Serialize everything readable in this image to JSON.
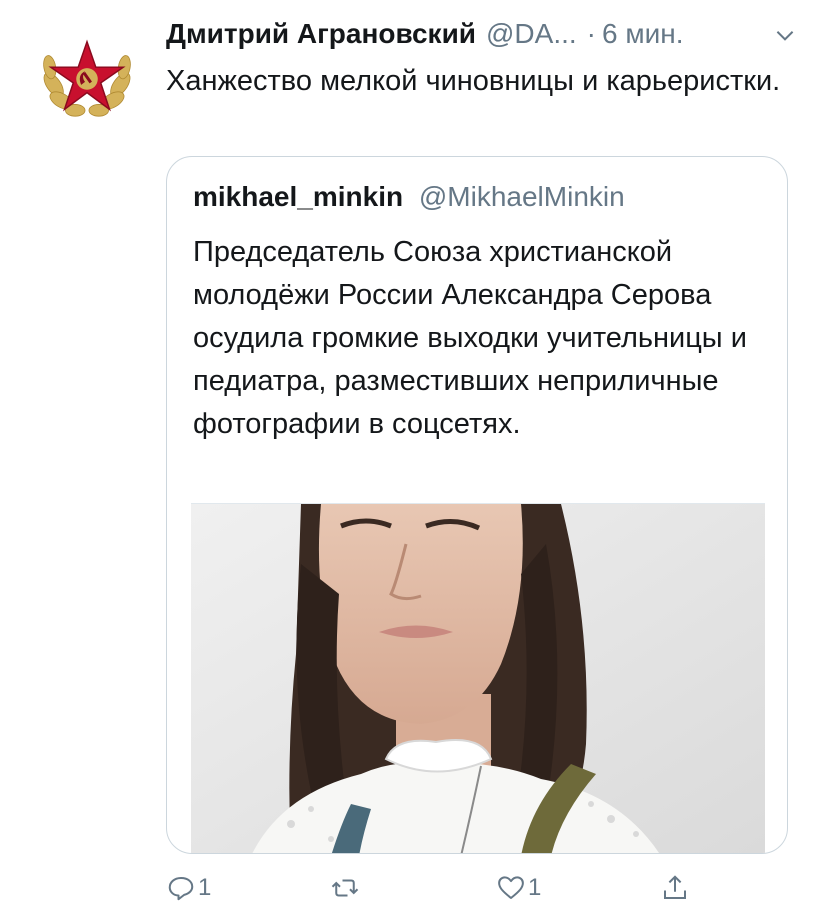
{
  "tweet": {
    "author_name": "Дмитрий Аграновский",
    "author_handle": "@DA...",
    "dot": "·",
    "time": "6 мин.",
    "text": "Ханжество мелкой чиновницы и карьеристки.",
    "avatar_icon": "soviet-star-cockade-icon",
    "menu_icon": "chevron-down-icon"
  },
  "quote": {
    "author_name": "mikhael_minkin",
    "author_handle": "@MikhaelMinkin",
    "text": "Председатель Союза христианской молодёжи России Александра Серова осудила громкие выходки учительницы и педиатра, разместивших неприличные фотографии в соцсетях.",
    "media": "photo"
  },
  "actions": {
    "reply_count": "1",
    "retweet_count": "",
    "like_count": "1",
    "reply_icon": "reply-icon",
    "retweet_icon": "retweet-icon",
    "like_icon": "heart-icon",
    "share_icon": "share-icon"
  },
  "colors": {
    "text": "#14171a",
    "secondary": "#657786",
    "border": "#ccd6dd",
    "emblem_red": "#c8102e",
    "emblem_gold": "#d4b25a"
  }
}
